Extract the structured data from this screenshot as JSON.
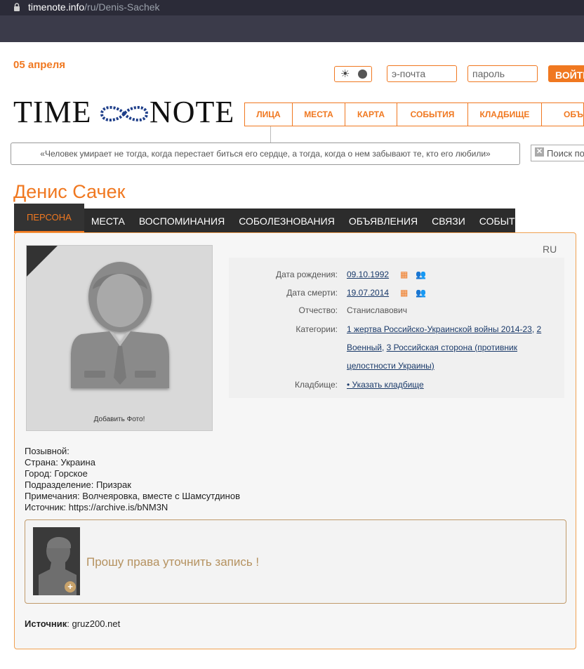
{
  "browser": {
    "url_host": "timenote.info",
    "url_path": "/ru/Denis-Sachek"
  },
  "header": {
    "date": "05 апреля",
    "email_placeholder": "э-почта",
    "password_placeholder": "пароль",
    "login_label": "ВОЙТИ",
    "logo_left": "TIME",
    "logo_right": "NOTE",
    "nav": [
      "ЛИЦА",
      "МЕСТА",
      "КАРТА",
      "СОБЫТИЯ",
      "КЛАДБИЩЕ",
      "ОБЪ"
    ],
    "quote": "«Человек умирает не тогда, когда перестает биться его сердце, а тогда, когда о нем забывают те, кто его любили»",
    "search_placeholder": "Поиск по"
  },
  "person": {
    "name": "Денис Сачек",
    "tabs": [
      "ПЕРСОНА",
      "МЕСТА",
      "ВОСПОМИНАНИЯ",
      "СОБОЛЕЗНОВАНИЯ",
      "ОБЪЯВЛЕНИЯ",
      "СВЯЗИ",
      "СОБЫТИЯ"
    ],
    "lang": "RU",
    "add_photo": "Добавить Фото!",
    "facts": {
      "birth_label": "Дата рождения:",
      "birth_value": "09.10.1992",
      "death_label": "Дата смерти:",
      "death_value": "19.07.2014",
      "patronymic_label": "Отчество:",
      "patronymic_value": "Станиславович",
      "categories_label": "Категории:",
      "categories_line1": "1 жертва Российско-Украинской войны 2014-23",
      "categories_sep1": ", ",
      "categories_line1b": "2",
      "categories_line2a": "Военный",
      "categories_sep2": ", ",
      "categories_line2b": "3 Российская сторона (противник",
      "categories_line3": "целостности Украины)",
      "cemetery_label": "Кладбище:",
      "cemetery_value": "• Указать кладбище"
    },
    "info_lines": [
      "Позывной:",
      "Страна: Украина",
      "Город: Горское",
      "Подразделение: Призрак",
      "Примечания: Волчеяровка, вместе с Шамсутдинов",
      "Источник: https://archive.is/bNM3N"
    ],
    "request_text": "Прошу права уточнить запись !",
    "source_label": "Источник",
    "source_value": ": gruz200.net"
  },
  "colors": {
    "accent": "#f07820",
    "link": "#1a3a6a",
    "tabbar": "#2c2c2c"
  }
}
